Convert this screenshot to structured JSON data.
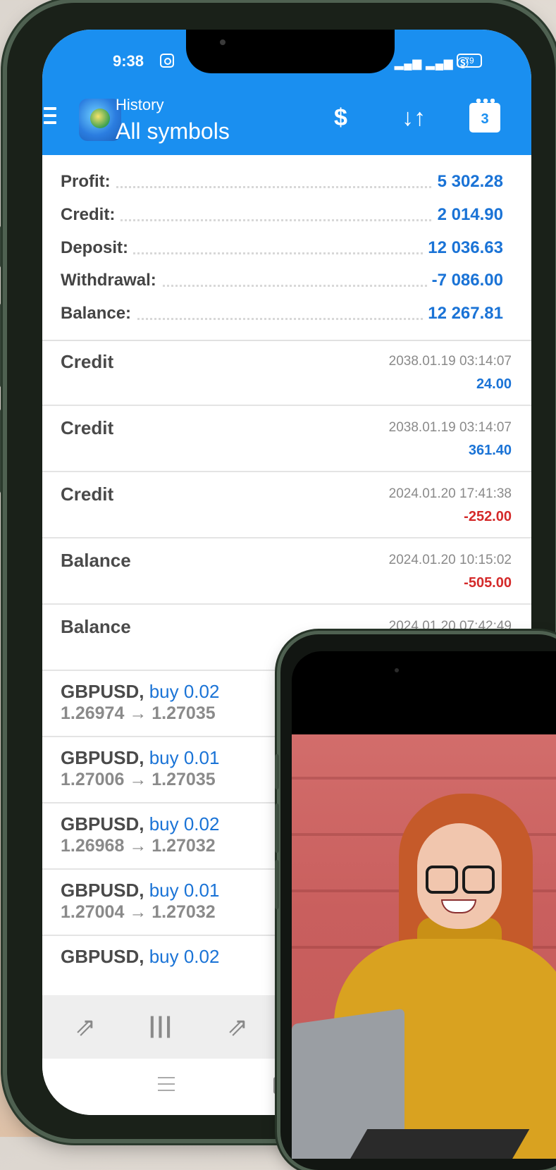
{
  "status_bar": {
    "time": "9:38",
    "battery": "79"
  },
  "app_bar": {
    "subtitle": "History",
    "title": "All symbols",
    "currency_icon": "$",
    "sort_icon": "↓↑",
    "calendar_day": "3"
  },
  "summary": [
    {
      "label": "Profit:",
      "value": "5 302.28"
    },
    {
      "label": "Credit:",
      "value": "2 014.90"
    },
    {
      "label": "Deposit:",
      "value": "12 036.63"
    },
    {
      "label": "Withdrawal:",
      "value": "-7 086.00"
    },
    {
      "label": "Balance:",
      "value": "12 267.81"
    }
  ],
  "history": [
    {
      "type": "Credit",
      "date": "2038.01.19 03:14:07",
      "amount": "24.00",
      "sign": "pos"
    },
    {
      "type": "Credit",
      "date": "2038.01.19 03:14:07",
      "amount": "361.40",
      "sign": "pos"
    },
    {
      "type": "Credit",
      "date": "2024.01.20 17:41:38",
      "amount": "-252.00",
      "sign": "neg"
    },
    {
      "type": "Balance",
      "date": "2024.01.20 10:15:02",
      "amount": "-505.00",
      "sign": "neg"
    },
    {
      "type": "Balance",
      "date": "2024.01.20 07:42:49",
      "amount": "",
      "sign": "pos"
    }
  ],
  "trades": [
    {
      "symbol": "GBPUSD,",
      "side": "buy 0.02",
      "prices": "1.26974 → 1.27035"
    },
    {
      "symbol": "GBPUSD,",
      "side": "buy 0.01",
      "prices": "1.27006 → 1.27035"
    },
    {
      "symbol": "GBPUSD,",
      "side": "buy 0.02",
      "prices": "1.26968 → 1.27032"
    },
    {
      "symbol": "GBPUSD,",
      "side": "buy 0.01",
      "prices": "1.27004 → 1.27032"
    },
    {
      "symbol": "GBPUSD,",
      "side": "buy 0.02",
      "prices": ""
    }
  ],
  "bottom_tabs": [
    {
      "icon": "quotes-icon",
      "glyph": "⇗"
    },
    {
      "icon": "chart-icon",
      "glyph": "┃┃┃"
    },
    {
      "icon": "trade-icon",
      "glyph": "⇗"
    }
  ]
}
